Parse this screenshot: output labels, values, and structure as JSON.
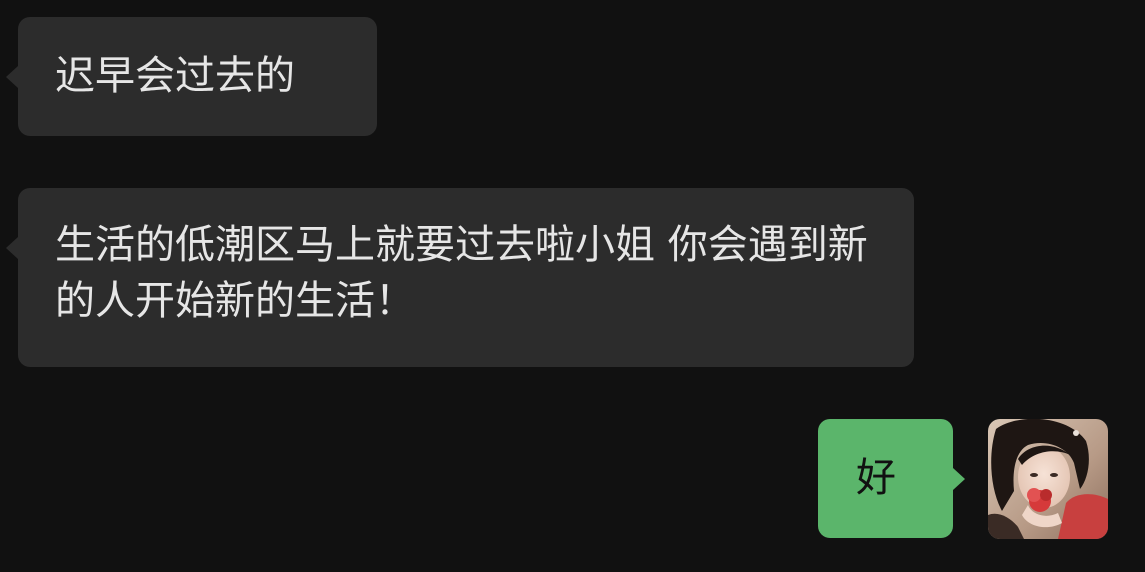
{
  "conversation": {
    "messages": [
      {
        "direction": "incoming",
        "text": "迟早会过去的"
      },
      {
        "direction": "incoming",
        "text": "生活的低潮区马上就要过去啦小姐 你会遇到新的人开始新的生活！"
      },
      {
        "direction": "outgoing",
        "text": "好"
      }
    ],
    "self_avatar_icon": "user-avatar-photo"
  },
  "colors": {
    "background": "#111111",
    "incoming_bubble": "#2c2c2c",
    "outgoing_bubble": "#5bb56b",
    "incoming_text": "#e6e6e6",
    "outgoing_text": "#111111"
  }
}
